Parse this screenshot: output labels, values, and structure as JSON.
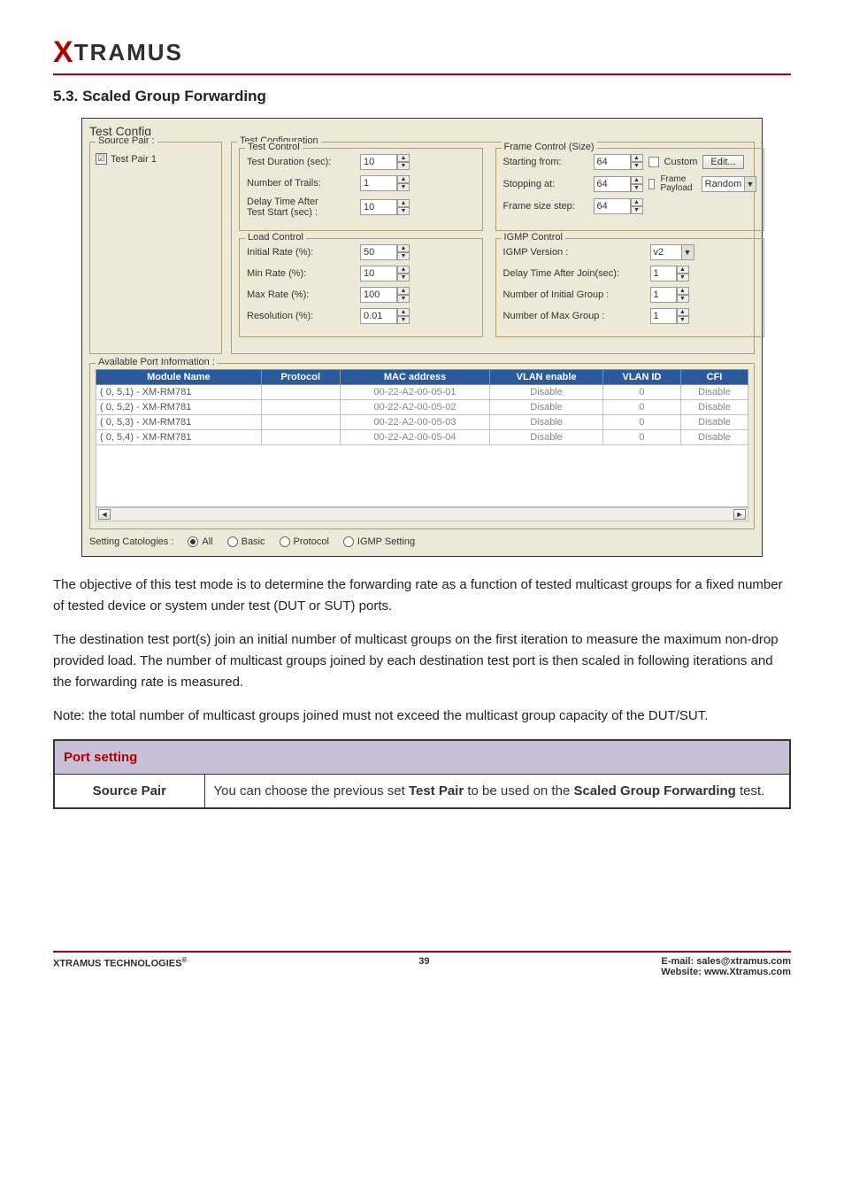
{
  "logo": {
    "first": "X",
    "rest": "TRAMUS"
  },
  "heading": "5.3. Scaled Group Forwarding",
  "shot": {
    "title": "Test Config",
    "source_pair": {
      "label": "Source Pair :",
      "item_checked": "☑",
      "item_label": "Test Pair 1"
    },
    "test_configuration_label": "Test Configuration",
    "test_control": {
      "label": "Test Control",
      "duration_label": "Test Duration (sec):",
      "duration_value": "10",
      "trails_label": "Number of Trails:",
      "trails_value": "1",
      "delay_label1": "Delay Time After",
      "delay_label2": "Test Start (sec) :",
      "delay_value": "10"
    },
    "load_control": {
      "label": "Load Control",
      "initial_label": "Initial Rate (%):",
      "initial_value": "50",
      "min_label": "Min Rate (%):",
      "min_value": "10",
      "max_label": "Max Rate (%):",
      "max_value": "100",
      "res_label": "Resolution (%):",
      "res_value": "0.01"
    },
    "frame_control": {
      "label": "Frame Control (Size)",
      "starting_label": "Starting from:",
      "starting_value": "64",
      "stopping_label": "Stopping at:",
      "stopping_value": "64",
      "step_label": "Frame size step:",
      "step_value": "64",
      "custom_label": "Custom",
      "edit_label": "Edit...",
      "frame_payload_label": "Frame Payload",
      "random_label": "Random"
    },
    "igmp_control": {
      "label": "IGMP Control",
      "version_label": "IGMP Version :",
      "version_value": "v2",
      "delay_join_label": "Delay Time After Join(sec):",
      "delay_join_value": "1",
      "initial_group_label": "Number of Initial Group :",
      "initial_group_value": "1",
      "max_group_label": "Number of Max Group :",
      "max_group_value": "1"
    },
    "available_port": {
      "label": "Available Port Information :",
      "headers": [
        "Module Name",
        "Protocol",
        "MAC address",
        "VLAN enable",
        "VLAN ID",
        "CFI"
      ],
      "rows": [
        {
          "module": "( 0, 5,1) - XM-RM781",
          "protocol": "",
          "mac": "00-22-A2-00-05-01",
          "vlan_enable": "Disable",
          "vlan_id": "0",
          "cfi": "Disable"
        },
        {
          "module": "( 0, 5,2) - XM-RM781",
          "protocol": "",
          "mac": "00-22-A2-00-05-02",
          "vlan_enable": "Disable",
          "vlan_id": "0",
          "cfi": "Disable"
        },
        {
          "module": "( 0, 5,3) - XM-RM781",
          "protocol": "",
          "mac": "00-22-A2-00-05-03",
          "vlan_enable": "Disable",
          "vlan_id": "0",
          "cfi": "Disable"
        },
        {
          "module": "( 0, 5,4) - XM-RM781",
          "protocol": "",
          "mac": "00-22-A2-00-05-04",
          "vlan_enable": "Disable",
          "vlan_id": "0",
          "cfi": "Disable"
        }
      ]
    },
    "settings_row": {
      "label": "Setting Catologies :",
      "opt_all": "All",
      "opt_basic": "Basic",
      "opt_protocol": "Protocol",
      "opt_igmp": "IGMP Setting"
    }
  },
  "para1": "The objective of this test mode is to determine the forwarding rate as a function of tested multicast groups for a fixed number of tested device or system under test (DUT or SUT) ports.",
  "para2": "The destination test port(s) join an initial number of multicast groups on the first iteration to measure the maximum non-drop provided load. The number of multicast groups joined by each destination test port is then scaled in following iterations and the forwarding rate is measured.",
  "para3": "Note: the total number of multicast groups joined must not exceed the multicast group capacity of the DUT/SUT.",
  "port_setting": {
    "header": "Port setting",
    "row1_label": "Source Pair",
    "row1_text_a": "You can choose the previous set ",
    "row1_text_b": "Test Pair",
    "row1_text_c": " to be used on the ",
    "row1_text_d": "Scaled Group Forwarding",
    "row1_text_e": " test."
  },
  "footer": {
    "left": "XTRAMUS TECHNOLOGIES",
    "reg": "®",
    "page": "39",
    "email_label": "E-mail: sales@xtramus.com",
    "web_label": "Website:  www.Xtramus.com"
  }
}
